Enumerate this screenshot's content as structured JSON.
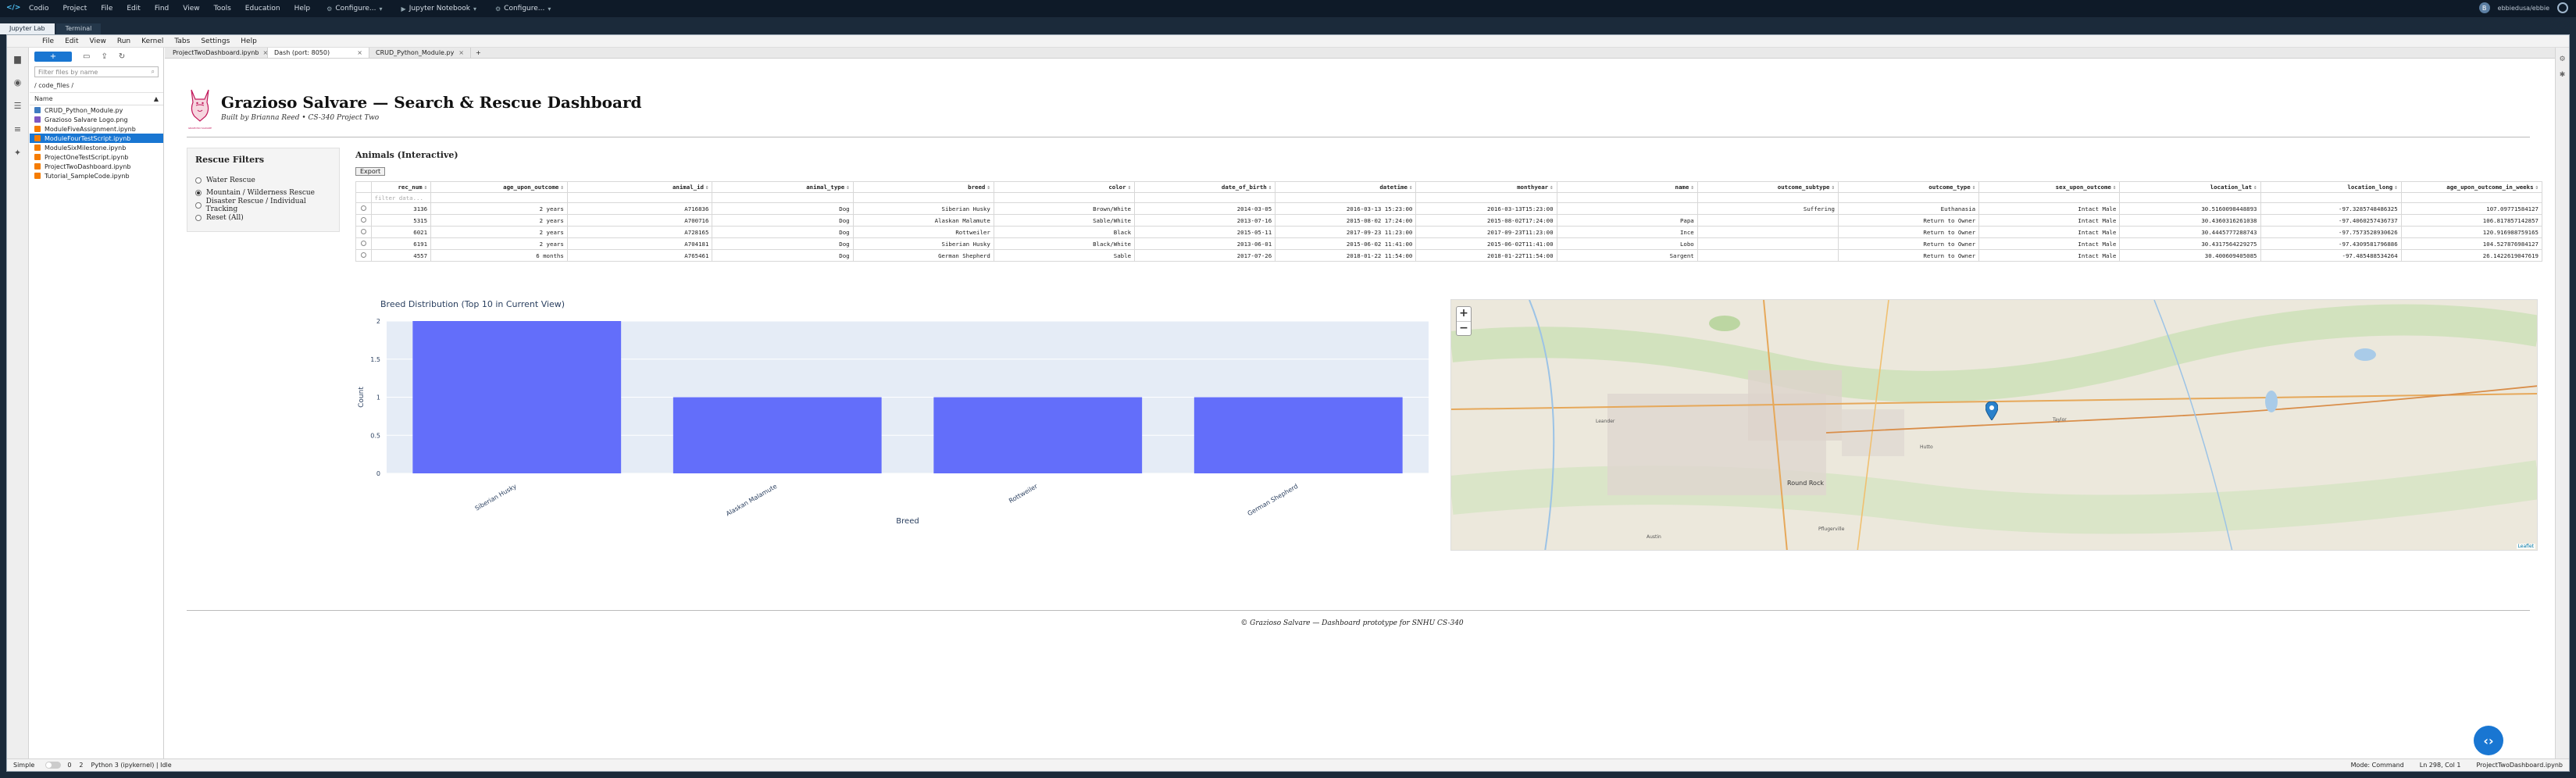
{
  "codio": {
    "menu": [
      "Codio",
      "Project",
      "File",
      "Edit",
      "Find",
      "View",
      "Tools",
      "Education",
      "Help"
    ],
    "dropdowns": [
      "Configure...",
      "Jupyter Notebook",
      "Configure..."
    ],
    "user": "ebbiedusa/ebbie"
  },
  "codio_tabs": [
    "Jupyter Lab",
    "Terminal"
  ],
  "jupyter": {
    "menu": [
      "File",
      "Edit",
      "View",
      "Run",
      "Kernel",
      "Tabs",
      "Settings",
      "Help"
    ]
  },
  "filebrowser": {
    "new_label": "+",
    "filter_placeholder": "Filter files by name",
    "path": "/ code_files /",
    "header_name": "Name",
    "header_modified": "▲",
    "files": [
      {
        "name": "CRUD_Python_Module.py",
        "kind": "py",
        "selected": false
      },
      {
        "name": "Grazioso Salvare Logo.png",
        "kind": "img",
        "selected": false
      },
      {
        "name": "ModuleFiveAssignment.ipynb",
        "kind": "nb",
        "selected": false
      },
      {
        "name": "ModuleFourTestScript.ipynb",
        "kind": "nb",
        "selected": true
      },
      {
        "name": "ModuleSixMilestone.ipynb",
        "kind": "nb",
        "selected": false
      },
      {
        "name": "ProjectOneTestScript.ipynb",
        "kind": "nb",
        "selected": false
      },
      {
        "name": "ProjectTwoDashboard.ipynb",
        "kind": "nb",
        "selected": false
      },
      {
        "name": "Tutorial_SampleCode.ipynb",
        "kind": "nb",
        "selected": false
      }
    ]
  },
  "doc_tabs": [
    {
      "label": "ProjectTwoDashboard.ipynb",
      "active": false
    },
    {
      "label": "Dash (port: 8050)",
      "active": true
    },
    {
      "label": "CRUD_Python_Module.py",
      "active": false
    }
  ],
  "dashboard": {
    "title": "Grazioso Salvare — Search & Rescue Dashboard",
    "subtitle": "Built by Brianna Reed • CS-340 Project Two",
    "logo_text": "GRAZIOSO SALVARE",
    "filter": {
      "title": "Rescue Filters",
      "options": [
        {
          "label": "Water Rescue",
          "checked": false
        },
        {
          "label": "Mountain / Wilderness Rescue",
          "checked": true
        },
        {
          "label": "Disaster Rescue / Individual Tracking",
          "checked": false
        },
        {
          "label": "Reset (All)",
          "checked": false
        }
      ]
    },
    "table": {
      "title": "Animals (Interactive)",
      "export_label": "Export",
      "filter_placeholder": "filter data...",
      "columns": [
        "rec_num",
        "age_upon_outcome",
        "animal_id",
        "animal_type",
        "breed",
        "color",
        "date_of_birth",
        "datetime",
        "monthyear",
        "name",
        "outcome_subtype",
        "outcome_type",
        "sex_upon_outcome",
        "location_lat",
        "location_long",
        "age_upon_outcome_in_weeks"
      ],
      "rows": [
        [
          "3136",
          "2 years",
          "A716836",
          "Dog",
          "Siberian Husky",
          "Brown/White",
          "2014-03-05",
          "2016-03-13 15:23:00",
          "2016-03-13T15:23:00",
          "",
          "Suffering",
          "Euthanasia",
          "Intact Male",
          "30.5160098448893",
          "-97.3285748486325",
          "107.09771584127"
        ],
        [
          "5315",
          "2 years",
          "A700716",
          "Dog",
          "Alaskan Malamute",
          "Sable/White",
          "2013-07-16",
          "2015-08-02 17:24:00",
          "2015-08-02T17:24:00",
          "Papa",
          "",
          "Return to Owner",
          "Intact Male",
          "30.4360316261038",
          "-97.4060257436737",
          "106.817857142857"
        ],
        [
          "6021",
          "2 years",
          "A728165",
          "Dog",
          "Rottweiler",
          "Black",
          "2015-05-11",
          "2017-09-23 11:23:00",
          "2017-09-23T11:23:00",
          "Ince",
          "",
          "Return to Owner",
          "Intact Male",
          "30.4445777288743",
          "-97.7573528930626",
          "120.916988759165"
        ],
        [
          "6191",
          "2 years",
          "A704181",
          "Dog",
          "Siberian Husky",
          "Black/White",
          "2013-06-01",
          "2015-06-02 11:41:00",
          "2015-06-02T11:41:00",
          "Lobo",
          "",
          "Return to Owner",
          "Intact Male",
          "30.4317564229275",
          "-97.4309581796886",
          "104.527876984127"
        ],
        [
          "4557",
          "6 months",
          "A765461",
          "Dog",
          "German Shepherd",
          "Sable",
          "2017-07-26",
          "2018-01-22 11:54:00",
          "2018-01-22T11:54:00",
          "Sargent",
          "",
          "Return to Owner",
          "Intact Male",
          "30.400609405085",
          "-97.485488534264",
          "26.1422619047619"
        ]
      ]
    },
    "footer": "© Grazioso Salvare — Dashboard prototype for SNHU CS-340"
  },
  "chart_data": {
    "type": "bar",
    "title": "Breed Distribution (Top 10 in Current View)",
    "categories": [
      "Siberian Husky",
      "Alaskan Malamute",
      "Rottweiler",
      "German Shepherd"
    ],
    "values": [
      2,
      1,
      1,
      1
    ],
    "xlabel": "Breed",
    "ylabel": "Count",
    "ylim": [
      0,
      2
    ],
    "yticks": [
      "0",
      "0.5",
      "1",
      "1.5",
      "2"
    ],
    "grid": true,
    "color": "#636efa"
  },
  "map": {
    "zoom_in": "+",
    "zoom_out": "−",
    "attribution": "Leaflet",
    "labels": [
      "Leander",
      "Round Rock",
      "Pflugerville",
      "Hutto",
      "Taylor",
      "Austin"
    ],
    "marker_color": "#2a81cb"
  },
  "status": {
    "mode_label": "Simple",
    "counts_a": "0",
    "counts_b": "2",
    "kernel": "Python 3 (ipykernel) | Idle",
    "mode": "Mode: Command",
    "position": "Ln 298, Col 1",
    "file": "ProjectTwoDashboard.ipynb"
  }
}
